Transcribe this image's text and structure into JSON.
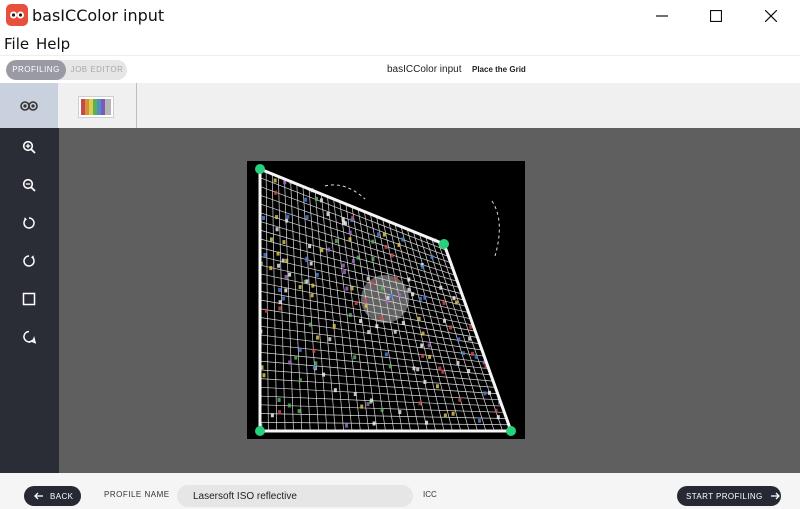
{
  "window": {
    "title": "basICColor input",
    "minimize_icon": "minimize-icon",
    "maximize_icon": "maximize-icon",
    "close_icon": "close-icon"
  },
  "menu": [
    "File",
    "Help"
  ],
  "modes": {
    "active": "PROFILING",
    "inactive": "JOB EDITOR"
  },
  "header": {
    "title": "basICColor input",
    "subtitle": "Place the Grid"
  },
  "tools": [
    "zoom-in-icon",
    "zoom-out-icon",
    "rotate-left-icon",
    "rotate-right-icon",
    "fit-frame-icon",
    "lasso-icon"
  ],
  "bottom": {
    "back_label": "BACK",
    "profile_name_label": "PROFILE NAME",
    "profile_name_value": "Lasersoft ISO reflective",
    "icc_label": "ICC",
    "start_label": "START PROFILING"
  },
  "colors": {
    "accent": "#262833",
    "sidebar": "#2b2d36",
    "canvas": "#5f5f5f",
    "corner_handle": "#26d07c",
    "logo": "#e84f3c"
  }
}
